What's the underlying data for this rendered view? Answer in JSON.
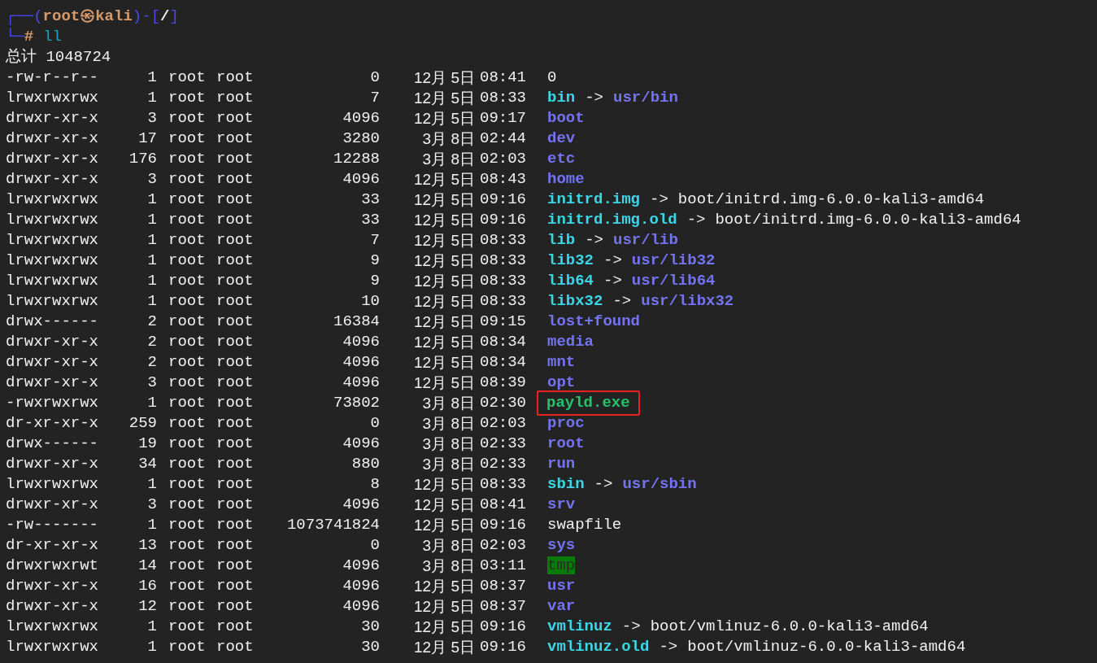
{
  "prompt": {
    "open": "┌──(",
    "user": "root㉿kali",
    "middle": ")-[",
    "cwd": "/",
    "close": "]",
    "corner": "└─",
    "symbol": "#",
    "command": "ll"
  },
  "total": "总计 1048724",
  "rows": [
    {
      "perms": "-rw-r--r--",
      "links": "1",
      "owner": "root",
      "group": "root",
      "size": "0",
      "date": "12月 5日",
      "time": "08:41",
      "name": "0",
      "kind": "file",
      "highlighted": false
    },
    {
      "perms": "lrwxrwxrwx",
      "links": "1",
      "owner": "root",
      "group": "root",
      "size": "7",
      "date": "12月 5日",
      "time": "08:33",
      "name": "bin",
      "kind": "link",
      "arrow": "->",
      "target": {
        "text": "usr/bin",
        "kind": "dir"
      },
      "highlighted": false
    },
    {
      "perms": "drwxr-xr-x",
      "links": "3",
      "owner": "root",
      "group": "root",
      "size": "4096",
      "date": "12月 5日",
      "time": "09:17",
      "name": "boot",
      "kind": "dir",
      "highlighted": false
    },
    {
      "perms": "drwxr-xr-x",
      "links": "17",
      "owner": "root",
      "group": "root",
      "size": "3280",
      "date": "3月 8日",
      "time": "02:44",
      "name": "dev",
      "kind": "dir",
      "highlighted": false
    },
    {
      "perms": "drwxr-xr-x",
      "links": "176",
      "owner": "root",
      "group": "root",
      "size": "12288",
      "date": "3月 8日",
      "time": "02:03",
      "name": "etc",
      "kind": "dir",
      "highlighted": false
    },
    {
      "perms": "drwxr-xr-x",
      "links": "3",
      "owner": "root",
      "group": "root",
      "size": "4096",
      "date": "12月 5日",
      "time": "08:43",
      "name": "home",
      "kind": "dir",
      "highlighted": false
    },
    {
      "perms": "lrwxrwxrwx",
      "links": "1",
      "owner": "root",
      "group": "root",
      "size": "33",
      "date": "12月 5日",
      "time": "09:16",
      "name": "initrd.img",
      "kind": "link",
      "arrow": "->",
      "target": {
        "text": "boot/initrd.img-6.0.0-kali3-amd64",
        "kind": "file"
      },
      "highlighted": false
    },
    {
      "perms": "lrwxrwxrwx",
      "links": "1",
      "owner": "root",
      "group": "root",
      "size": "33",
      "date": "12月 5日",
      "time": "09:16",
      "name": "initrd.img.old",
      "kind": "link",
      "arrow": "->",
      "target": {
        "text": "boot/initrd.img-6.0.0-kali3-amd64",
        "kind": "file"
      },
      "highlighted": false
    },
    {
      "perms": "lrwxrwxrwx",
      "links": "1",
      "owner": "root",
      "group": "root",
      "size": "7",
      "date": "12月 5日",
      "time": "08:33",
      "name": "lib",
      "kind": "link",
      "arrow": "->",
      "target": {
        "text": "usr/lib",
        "kind": "dir"
      },
      "highlighted": false
    },
    {
      "perms": "lrwxrwxrwx",
      "links": "1",
      "owner": "root",
      "group": "root",
      "size": "9",
      "date": "12月 5日",
      "time": "08:33",
      "name": "lib32",
      "kind": "link",
      "arrow": "->",
      "target": {
        "text": "usr/lib32",
        "kind": "dir"
      },
      "highlighted": false
    },
    {
      "perms": "lrwxrwxrwx",
      "links": "1",
      "owner": "root",
      "group": "root",
      "size": "9",
      "date": "12月 5日",
      "time": "08:33",
      "name": "lib64",
      "kind": "link",
      "arrow": "->",
      "target": {
        "text": "usr/lib64",
        "kind": "dir"
      },
      "highlighted": false
    },
    {
      "perms": "lrwxrwxrwx",
      "links": "1",
      "owner": "root",
      "group": "root",
      "size": "10",
      "date": "12月 5日",
      "time": "08:33",
      "name": "libx32",
      "kind": "link",
      "arrow": "->",
      "target": {
        "text": "usr/libx32",
        "kind": "dir"
      },
      "highlighted": false
    },
    {
      "perms": "drwx------",
      "links": "2",
      "owner": "root",
      "group": "root",
      "size": "16384",
      "date": "12月 5日",
      "time": "09:15",
      "name": "lost+found",
      "kind": "dir",
      "highlighted": false
    },
    {
      "perms": "drwxr-xr-x",
      "links": "2",
      "owner": "root",
      "group": "root",
      "size": "4096",
      "date": "12月 5日",
      "time": "08:34",
      "name": "media",
      "kind": "dir",
      "highlighted": false
    },
    {
      "perms": "drwxr-xr-x",
      "links": "2",
      "owner": "root",
      "group": "root",
      "size": "4096",
      "date": "12月 5日",
      "time": "08:34",
      "name": "mnt",
      "kind": "dir",
      "highlighted": false
    },
    {
      "perms": "drwxr-xr-x",
      "links": "3",
      "owner": "root",
      "group": "root",
      "size": "4096",
      "date": "12月 5日",
      "time": "08:39",
      "name": "opt",
      "kind": "dir",
      "highlighted": false
    },
    {
      "perms": "-rwxrwxrwx",
      "links": "1",
      "owner": "root",
      "group": "root",
      "size": "73802",
      "date": "3月 8日",
      "time": "02:30",
      "name": "payld.exe",
      "kind": "exec",
      "highlighted": true
    },
    {
      "perms": "dr-xr-xr-x",
      "links": "259",
      "owner": "root",
      "group": "root",
      "size": "0",
      "date": "3月 8日",
      "time": "02:03",
      "name": "proc",
      "kind": "dir",
      "highlighted": false
    },
    {
      "perms": "drwx------",
      "links": "19",
      "owner": "root",
      "group": "root",
      "size": "4096",
      "date": "3月 8日",
      "time": "02:33",
      "name": "root",
      "kind": "dir",
      "highlighted": false
    },
    {
      "perms": "drwxr-xr-x",
      "links": "34",
      "owner": "root",
      "group": "root",
      "size": "880",
      "date": "3月 8日",
      "time": "02:33",
      "name": "run",
      "kind": "dir",
      "highlighted": false
    },
    {
      "perms": "lrwxrwxrwx",
      "links": "1",
      "owner": "root",
      "group": "root",
      "size": "8",
      "date": "12月 5日",
      "time": "08:33",
      "name": "sbin",
      "kind": "link",
      "arrow": "->",
      "target": {
        "text": "usr/sbin",
        "kind": "dir"
      },
      "highlighted": false
    },
    {
      "perms": "drwxr-xr-x",
      "links": "3",
      "owner": "root",
      "group": "root",
      "size": "4096",
      "date": "12月 5日",
      "time": "08:41",
      "name": "srv",
      "kind": "dir",
      "highlighted": false
    },
    {
      "perms": "-rw-------",
      "links": "1",
      "owner": "root",
      "group": "root",
      "size": "1073741824",
      "date": "12月 5日",
      "time": "09:16",
      "name": "swapfile",
      "kind": "file",
      "highlighted": false
    },
    {
      "perms": "dr-xr-xr-x",
      "links": "13",
      "owner": "root",
      "group": "root",
      "size": "0",
      "date": "3月 8日",
      "time": "02:03",
      "name": "sys",
      "kind": "dir",
      "highlighted": false
    },
    {
      "perms": "drwxrwxrwt",
      "links": "14",
      "owner": "root",
      "group": "root",
      "size": "4096",
      "date": "3月 8日",
      "time": "03:11",
      "name": "tmp",
      "kind": "sticky",
      "highlighted": false
    },
    {
      "perms": "drwxr-xr-x",
      "links": "16",
      "owner": "root",
      "group": "root",
      "size": "4096",
      "date": "12月 5日",
      "time": "08:37",
      "name": "usr",
      "kind": "dir",
      "highlighted": false
    },
    {
      "perms": "drwxr-xr-x",
      "links": "12",
      "owner": "root",
      "group": "root",
      "size": "4096",
      "date": "12月 5日",
      "time": "08:37",
      "name": "var",
      "kind": "dir",
      "highlighted": false
    },
    {
      "perms": "lrwxrwxrwx",
      "links": "1",
      "owner": "root",
      "group": "root",
      "size": "30",
      "date": "12月 5日",
      "time": "09:16",
      "name": "vmlinuz",
      "kind": "link",
      "arrow": "->",
      "target": {
        "text": "boot/vmlinuz-6.0.0-kali3-amd64",
        "kind": "file"
      },
      "highlighted": false
    },
    {
      "perms": "lrwxrwxrwx",
      "links": "1",
      "owner": "root",
      "group": "root",
      "size": "30",
      "date": "12月 5日",
      "time": "09:16",
      "name": "vmlinuz.old",
      "kind": "link",
      "arrow": "->",
      "target": {
        "text": "boot/vmlinuz-6.0.0-kali3-amd64",
        "kind": "file"
      },
      "highlighted": false
    }
  ]
}
